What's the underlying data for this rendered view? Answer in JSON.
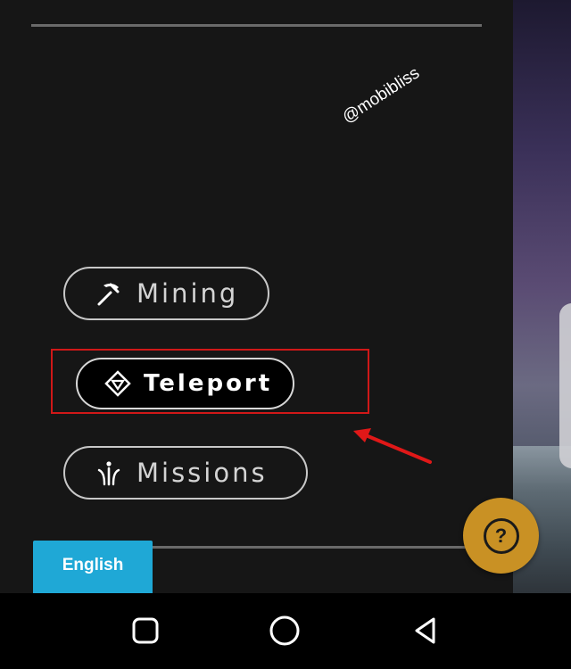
{
  "watermark": "@mobibliss",
  "menu": {
    "mining": {
      "label": "Mining",
      "icon": "pickaxe-icon"
    },
    "teleport": {
      "label": "Teleport",
      "icon": "diamond-icon"
    },
    "missions": {
      "label": "Missions",
      "icon": "trident-icon"
    }
  },
  "language_button": {
    "label": "English"
  },
  "help_fab": {
    "glyph": "?",
    "icon": "help-icon"
  },
  "colors": {
    "background": "#161616",
    "language_button": "#1fa8d6",
    "help_fab": "#c99124",
    "highlight": "#d01818"
  },
  "navbar": {
    "buttons": [
      "recents-icon",
      "home-icon",
      "back-icon"
    ]
  }
}
